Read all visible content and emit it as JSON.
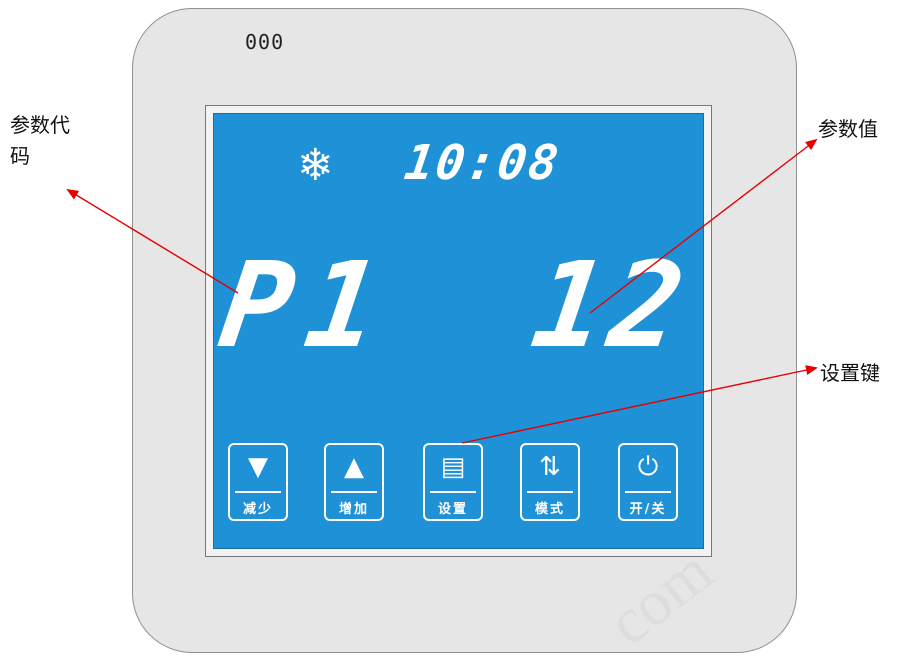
{
  "device": {
    "led_text": "000",
    "screen_color": "#1f91d6",
    "status_icon": "snowflake-icon",
    "clock": "10:08",
    "param_code": "P1",
    "param_value": "12",
    "keys": [
      {
        "icon": "triangle-down-icon",
        "symbol": "▼",
        "label": "减少"
      },
      {
        "icon": "triangle-up-icon",
        "symbol": "▲",
        "label": "增加"
      },
      {
        "icon": "settings-icon",
        "symbol": "▤",
        "label": "设置"
      },
      {
        "icon": "mode-icon",
        "symbol": "⇅",
        "label": "模式"
      },
      {
        "icon": "power-icon",
        "symbol": "⏻",
        "label": "开/关"
      }
    ]
  },
  "callouts": {
    "param_code": "参数代码",
    "param_value": "参数值",
    "set_key": "设置键"
  },
  "watermark": "com",
  "colors": {
    "arrow": "#e60000",
    "screen": "#1f91d6",
    "housing": "#e6e6e6"
  }
}
